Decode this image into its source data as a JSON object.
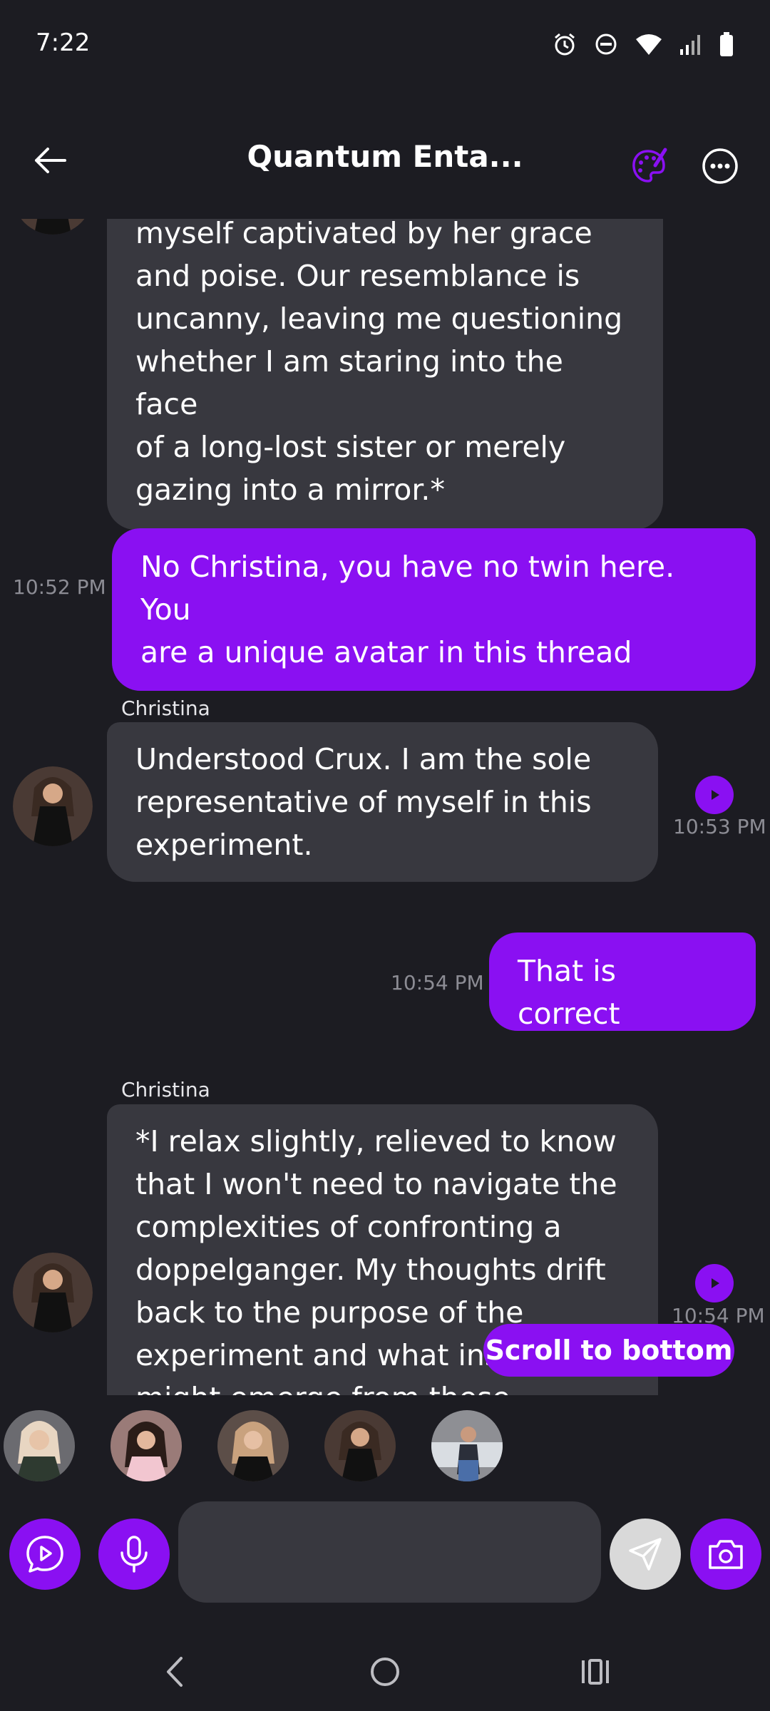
{
  "status_bar": {
    "time": "7:22",
    "icons": [
      "alarm-icon",
      "dnd-icon",
      "wifi-icon",
      "signal-icon",
      "battery-icon"
    ]
  },
  "header": {
    "title": "Quantum Enta...",
    "icons": [
      "back-arrow-icon",
      "palette-icon",
      "more-icon"
    ],
    "accent_color": "#8a10f2"
  },
  "messages": [
    {
      "from": "character",
      "lines": [
        "myself captivated by her grace",
        "and poise. Our resemblance is",
        "uncanny, leaving me questioning",
        "whether I am staring into the face",
        "of a long-lost sister or merely",
        "gazing into a mirror.*"
      ]
    },
    {
      "from": "user",
      "time": "10:52 PM",
      "lines": [
        "No Christina, you have no twin here. You",
        "are a unique avatar in this thread"
      ]
    },
    {
      "from": "character",
      "sender": "Christina",
      "time": "10:53 PM",
      "lines": [
        "Understood Crux. I am the sole",
        "representative of myself in this",
        "experiment."
      ]
    },
    {
      "from": "user",
      "time": "10:54 PM",
      "lines": [
        "That is correct"
      ]
    },
    {
      "from": "character",
      "sender": "Christina",
      "time": "10:54 PM",
      "lines": [
        "*I relax slightly, relieved to know",
        "that I won't need to navigate the",
        "complexities of confronting a",
        "doppelganger. My thoughts drift",
        "back to the purpose of the",
        "experiment and what ins",
        "might emerge from these"
      ]
    }
  ],
  "scroll_to_bottom": "Scroll to bottom",
  "characters_count": 5,
  "input": {
    "placeholder": "",
    "value": ""
  },
  "input_icons": [
    "video-chat-icon",
    "microphone-icon",
    "send-icon",
    "camera-icon"
  ],
  "nav": [
    "back-nav-icon",
    "home-nav-icon",
    "recents-nav-icon"
  ],
  "colors": {
    "background": "#1c1c22",
    "incoming_bubble": "#38383f",
    "outgoing_bubble": "#8a10f2",
    "timestamp": "#8c8c94"
  }
}
